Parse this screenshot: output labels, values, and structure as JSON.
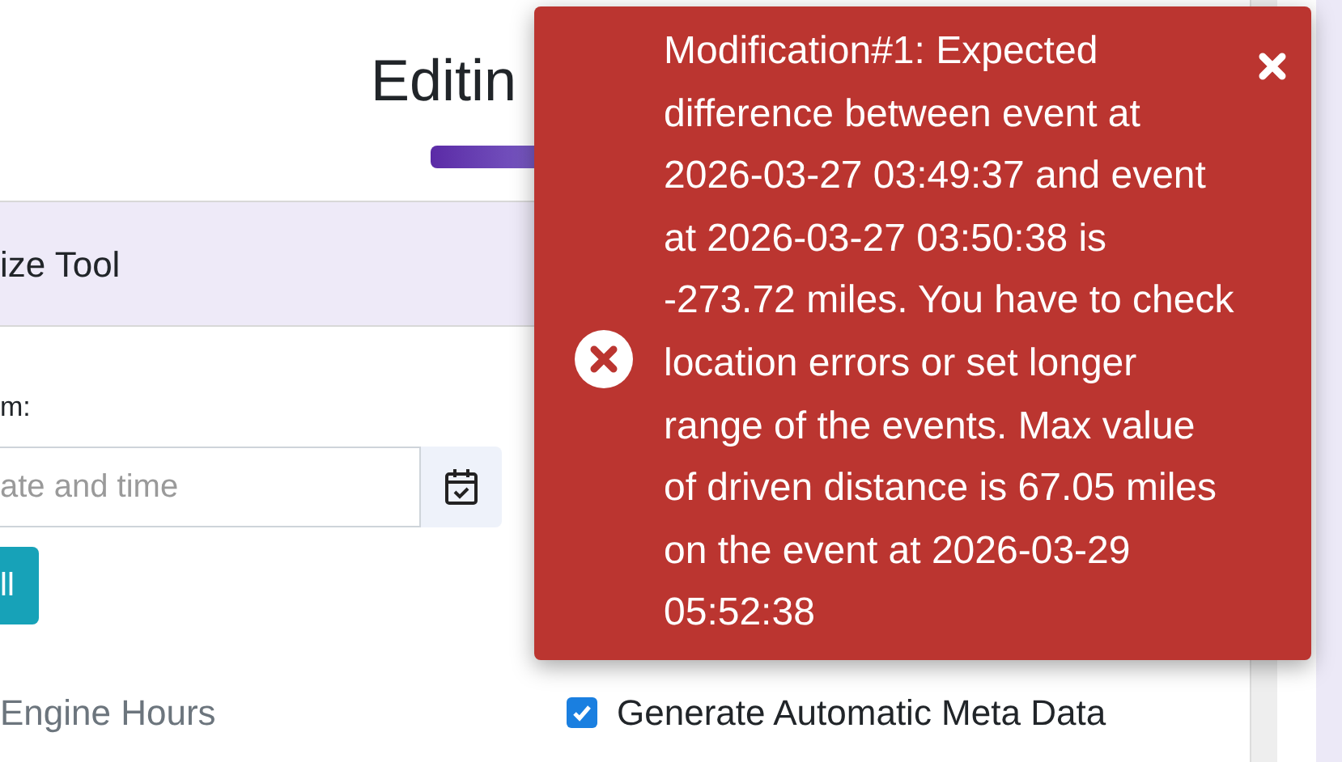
{
  "page_title": "Editin",
  "panel": {
    "title": "ize Tool",
    "field_label": "m:",
    "datetime_field": {
      "placeholder": "ate and time"
    },
    "button": "ll",
    "engine_hours_label": "Engine Hours",
    "meta_data_option": {
      "label": "Generate Automatic Meta Data",
      "checked": true
    }
  },
  "toast": {
    "message_lines": [
      "Modification#1: Expected",
      "difference between event at",
      "2026-03-27 03:49:37 and event",
      "at 2026-03-27 03:50:38 is",
      "-273.72 miles. You have to check",
      "location errors or set longer",
      "range of the events. Max value",
      "of driven distance is 67.05 miles",
      "on the event at 2026-03-29",
      "05:52:38"
    ]
  }
}
